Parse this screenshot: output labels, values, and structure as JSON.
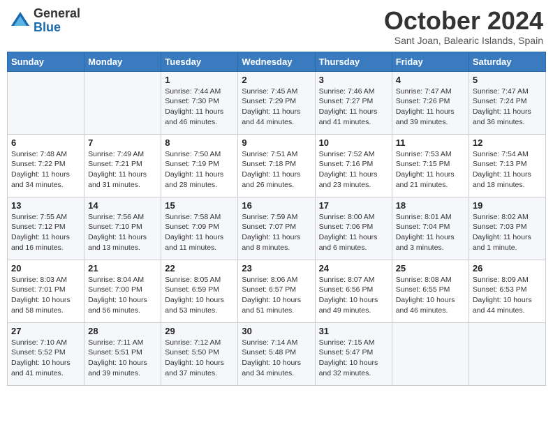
{
  "header": {
    "logo_general": "General",
    "logo_blue": "Blue",
    "month_title": "October 2024",
    "subtitle": "Sant Joan, Balearic Islands, Spain"
  },
  "weekdays": [
    "Sunday",
    "Monday",
    "Tuesday",
    "Wednesday",
    "Thursday",
    "Friday",
    "Saturday"
  ],
  "weeks": [
    [
      null,
      null,
      {
        "day": 1,
        "sunrise": "7:44 AM",
        "sunset": "7:30 PM",
        "daylight": "11 hours and 46 minutes."
      },
      {
        "day": 2,
        "sunrise": "7:45 AM",
        "sunset": "7:29 PM",
        "daylight": "11 hours and 44 minutes."
      },
      {
        "day": 3,
        "sunrise": "7:46 AM",
        "sunset": "7:27 PM",
        "daylight": "11 hours and 41 minutes."
      },
      {
        "day": 4,
        "sunrise": "7:47 AM",
        "sunset": "7:26 PM",
        "daylight": "11 hours and 39 minutes."
      },
      {
        "day": 5,
        "sunrise": "7:47 AM",
        "sunset": "7:24 PM",
        "daylight": "11 hours and 36 minutes."
      }
    ],
    [
      {
        "day": 6,
        "sunrise": "7:48 AM",
        "sunset": "7:22 PM",
        "daylight": "11 hours and 34 minutes."
      },
      {
        "day": 7,
        "sunrise": "7:49 AM",
        "sunset": "7:21 PM",
        "daylight": "11 hours and 31 minutes."
      },
      {
        "day": 8,
        "sunrise": "7:50 AM",
        "sunset": "7:19 PM",
        "daylight": "11 hours and 28 minutes."
      },
      {
        "day": 9,
        "sunrise": "7:51 AM",
        "sunset": "7:18 PM",
        "daylight": "11 hours and 26 minutes."
      },
      {
        "day": 10,
        "sunrise": "7:52 AM",
        "sunset": "7:16 PM",
        "daylight": "11 hours and 23 minutes."
      },
      {
        "day": 11,
        "sunrise": "7:53 AM",
        "sunset": "7:15 PM",
        "daylight": "11 hours and 21 minutes."
      },
      {
        "day": 12,
        "sunrise": "7:54 AM",
        "sunset": "7:13 PM",
        "daylight": "11 hours and 18 minutes."
      }
    ],
    [
      {
        "day": 13,
        "sunrise": "7:55 AM",
        "sunset": "7:12 PM",
        "daylight": "11 hours and 16 minutes."
      },
      {
        "day": 14,
        "sunrise": "7:56 AM",
        "sunset": "7:10 PM",
        "daylight": "11 hours and 13 minutes."
      },
      {
        "day": 15,
        "sunrise": "7:58 AM",
        "sunset": "7:09 PM",
        "daylight": "11 hours and 11 minutes."
      },
      {
        "day": 16,
        "sunrise": "7:59 AM",
        "sunset": "7:07 PM",
        "daylight": "11 hours and 8 minutes."
      },
      {
        "day": 17,
        "sunrise": "8:00 AM",
        "sunset": "7:06 PM",
        "daylight": "11 hours and 6 minutes."
      },
      {
        "day": 18,
        "sunrise": "8:01 AM",
        "sunset": "7:04 PM",
        "daylight": "11 hours and 3 minutes."
      },
      {
        "day": 19,
        "sunrise": "8:02 AM",
        "sunset": "7:03 PM",
        "daylight": "11 hours and 1 minute."
      }
    ],
    [
      {
        "day": 20,
        "sunrise": "8:03 AM",
        "sunset": "7:01 PM",
        "daylight": "10 hours and 58 minutes."
      },
      {
        "day": 21,
        "sunrise": "8:04 AM",
        "sunset": "7:00 PM",
        "daylight": "10 hours and 56 minutes."
      },
      {
        "day": 22,
        "sunrise": "8:05 AM",
        "sunset": "6:59 PM",
        "daylight": "10 hours and 53 minutes."
      },
      {
        "day": 23,
        "sunrise": "8:06 AM",
        "sunset": "6:57 PM",
        "daylight": "10 hours and 51 minutes."
      },
      {
        "day": 24,
        "sunrise": "8:07 AM",
        "sunset": "6:56 PM",
        "daylight": "10 hours and 49 minutes."
      },
      {
        "day": 25,
        "sunrise": "8:08 AM",
        "sunset": "6:55 PM",
        "daylight": "10 hours and 46 minutes."
      },
      {
        "day": 26,
        "sunrise": "8:09 AM",
        "sunset": "6:53 PM",
        "daylight": "10 hours and 44 minutes."
      }
    ],
    [
      {
        "day": 27,
        "sunrise": "7:10 AM",
        "sunset": "5:52 PM",
        "daylight": "10 hours and 41 minutes."
      },
      {
        "day": 28,
        "sunrise": "7:11 AM",
        "sunset": "5:51 PM",
        "daylight": "10 hours and 39 minutes."
      },
      {
        "day": 29,
        "sunrise": "7:12 AM",
        "sunset": "5:50 PM",
        "daylight": "10 hours and 37 minutes."
      },
      {
        "day": 30,
        "sunrise": "7:14 AM",
        "sunset": "5:48 PM",
        "daylight": "10 hours and 34 minutes."
      },
      {
        "day": 31,
        "sunrise": "7:15 AM",
        "sunset": "5:47 PM",
        "daylight": "10 hours and 32 minutes."
      },
      null,
      null
    ]
  ]
}
